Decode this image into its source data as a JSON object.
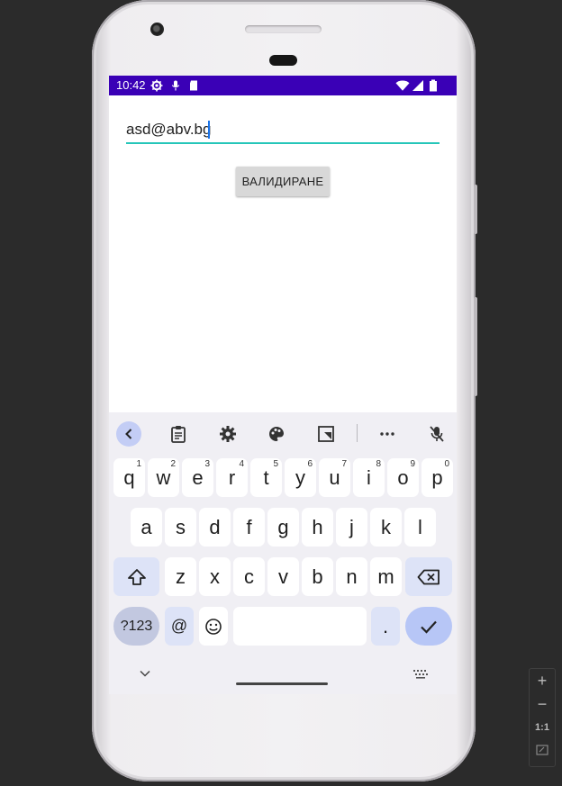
{
  "status_bar": {
    "time": "10:42",
    "left_icons": [
      "gear-icon",
      "mic-icon",
      "sd-card-icon"
    ],
    "right_icons": [
      "wifi-icon",
      "signal-icon",
      "battery-icon"
    ],
    "bar_color": "#3a00b6"
  },
  "form": {
    "email_value": "asd@abv.bg",
    "validate_label": "ВАЛИДИРАНЕ",
    "underline_color": "#26c6b9"
  },
  "keyboard": {
    "toolbar": [
      "back-icon",
      "clipboard-icon",
      "settings-icon",
      "palette-icon",
      "resize-icon",
      "more-icon",
      "mic-off-icon"
    ],
    "row1": [
      {
        "key": "q",
        "hint": "1"
      },
      {
        "key": "w",
        "hint": "2"
      },
      {
        "key": "e",
        "hint": "3"
      },
      {
        "key": "r",
        "hint": "4"
      },
      {
        "key": "t",
        "hint": "5"
      },
      {
        "key": "y",
        "hint": "6"
      },
      {
        "key": "u",
        "hint": "7"
      },
      {
        "key": "i",
        "hint": "8"
      },
      {
        "key": "o",
        "hint": "9"
      },
      {
        "key": "p",
        "hint": "0"
      }
    ],
    "row2": [
      "a",
      "s",
      "d",
      "f",
      "g",
      "h",
      "j",
      "k",
      "l"
    ],
    "row3": [
      "z",
      "x",
      "c",
      "v",
      "b",
      "n",
      "m"
    ],
    "symbols_label": "?123",
    "at_label": "@",
    "period_label": ".",
    "accent_color": "#b7c6f6"
  },
  "zoom_controls": {
    "plus": "+",
    "minus": "−",
    "one_to_one": "1:1"
  }
}
